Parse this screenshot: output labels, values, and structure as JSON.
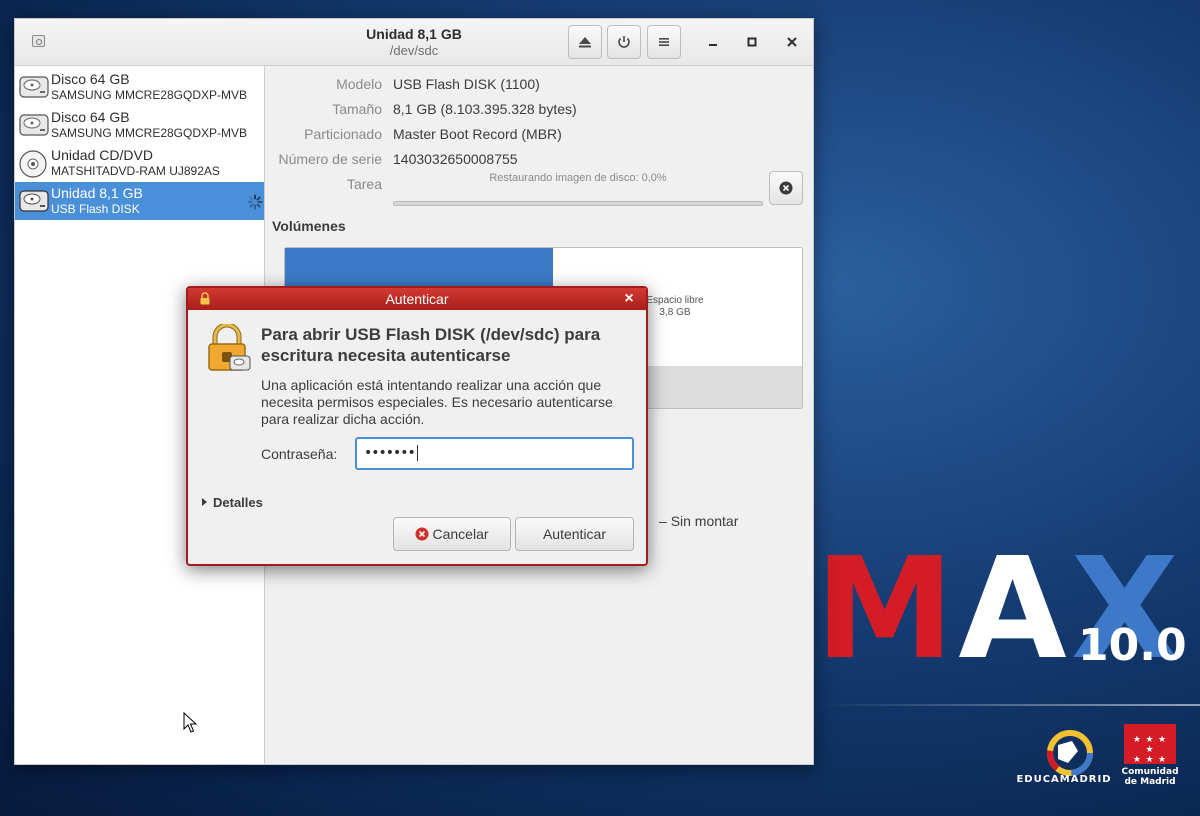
{
  "window": {
    "title": "Unidad 8,1 GB",
    "subtitle": "/dev/sdc"
  },
  "sidebar": {
    "items": [
      {
        "name": "Disco 64 GB",
        "model": "SAMSUNG MMCRE28GQDXP-MVB",
        "icon": "hard-disk-icon",
        "selected": false
      },
      {
        "name": "Disco 64 GB",
        "model": "SAMSUNG MMCRE28GQDXP-MVB",
        "icon": "hard-disk-icon",
        "selected": false
      },
      {
        "name": "Unidad CD/DVD",
        "model": "MATSHITADVD-RAM UJ892AS",
        "icon": "optical-disc-icon",
        "selected": false
      },
      {
        "name": "Unidad 8,1 GB",
        "model": "USB Flash DISK",
        "icon": "usb-drive-icon",
        "selected": true
      }
    ]
  },
  "details": {
    "model_label": "Modelo",
    "model_value": "USB Flash DISK (1100)",
    "size_label": "Tamaño",
    "size_value": "8,1 GB (8.103.395.328 bytes)",
    "partitioning_label": "Particionado",
    "partitioning_value": "Master Boot Record (MBR)",
    "serial_label": "Número de serie",
    "serial_value": "1403032650008755",
    "task_label": "Tarea",
    "task_text": "Restaurando imagen de disco: 0,0%",
    "task_progress": 0.0
  },
  "volumes": {
    "title": "Volúmenes",
    "free_label": "Espacio libre",
    "free_size": "3,8 GB",
    "mount_status": "Sin montar"
  },
  "auth_dialog": {
    "title": "Autenticar",
    "heading": "Para abrir USB Flash DISK (/dev/sdc) para escritura necesita autenticarse",
    "body": "Una aplicación está intentando realizar una acción que necesita permisos especiales. Es necesario autenticarse para realizar dicha acción.",
    "password_label": "Contraseña:",
    "password_value": "•••••••",
    "details_label": "Detalles",
    "cancel_label": "Cancelar",
    "authenticate_label": "Autenticar"
  },
  "desktop": {
    "logo_m": "M",
    "logo_a": "A",
    "logo_x": "X",
    "version": "10.0",
    "educamadrid": "EDUCAMADRID",
    "comunidad_line1": "Comunidad",
    "comunidad_line2": "de Madrid"
  },
  "colors": {
    "selection": "#4a90d9",
    "dialog_titlebar": "#b5231f",
    "partition": "#3d7bc8"
  }
}
